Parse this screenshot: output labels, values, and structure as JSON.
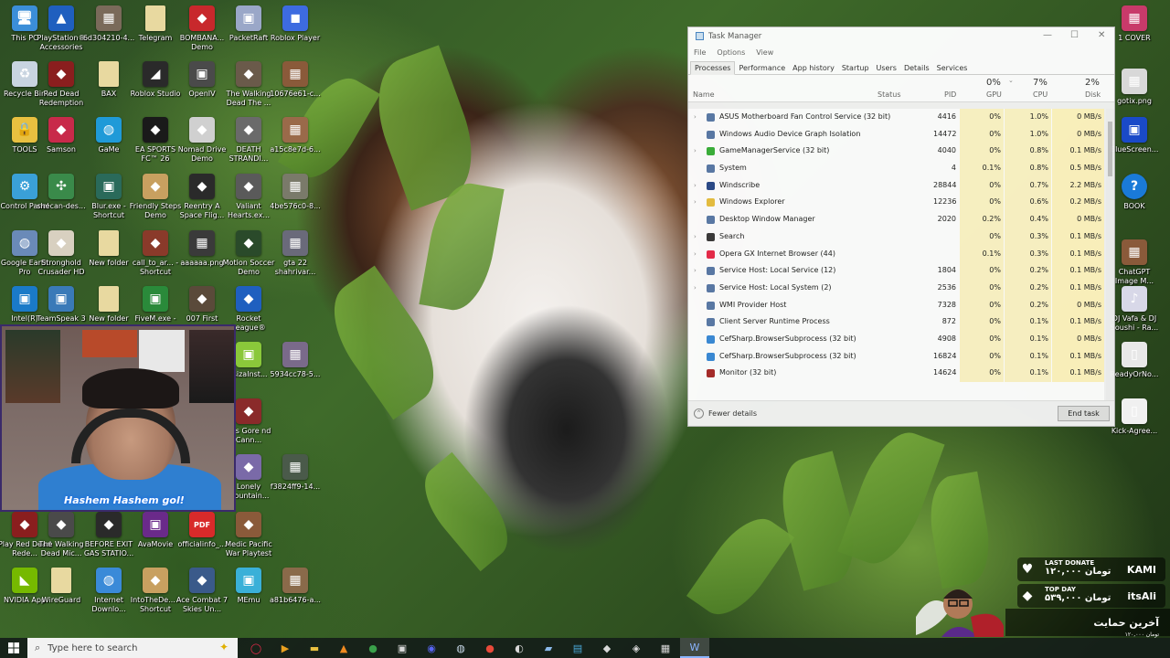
{
  "desktop_icons": [
    {
      "label": "This PC",
      "icon": "pc-icon",
      "color": "#3b8ed8",
      "col": 0,
      "row": 0
    },
    {
      "label": "PlayStation® Accessories",
      "icon": "playstation-icon",
      "color": "#1f5fbf",
      "col": 1,
      "row": 0
    },
    {
      "label": "6d304210-4...",
      "icon": "image-thumb-icon",
      "color": "#7a6a5a",
      "col": 2,
      "row": 0
    },
    {
      "label": "Telegram",
      "icon": "folder-icon",
      "color": "#e8d9a0",
      "col": 3,
      "row": 0
    },
    {
      "label": "BOMBANA... Demo",
      "icon": "game-icon",
      "color": "#c8282c",
      "col": 4,
      "row": 0
    },
    {
      "label": "PacketRaft",
      "icon": "app-icon",
      "color": "#9aa7c8",
      "col": 5,
      "row": 0
    },
    {
      "label": "Roblox Player",
      "icon": "roblox-icon",
      "color": "#3d6be0",
      "col": 6,
      "row": 0
    },
    {
      "label": "Recycle Bin",
      "icon": "recycle-bin-icon",
      "color": "#c8d4e0",
      "col": 0,
      "row": 1
    },
    {
      "label": "Red Dead Redemption",
      "icon": "game-icon",
      "color": "#8a1e1e",
      "col": 1,
      "row": 1
    },
    {
      "label": "BAX",
      "icon": "folder-icon",
      "color": "#e8d9a0",
      "col": 2,
      "row": 1
    },
    {
      "label": "Roblox Studio",
      "icon": "roblox-studio-icon",
      "color": "#2a2a2a",
      "col": 3,
      "row": 1
    },
    {
      "label": "OpenIV",
      "icon": "app-icon",
      "color": "#4a4a4a",
      "col": 4,
      "row": 1
    },
    {
      "label": "The Walking Dead The ...",
      "icon": "game-icon",
      "color": "#6a5a4a",
      "col": 5,
      "row": 1
    },
    {
      "label": "10676e61-c...",
      "icon": "image-thumb-icon",
      "color": "#8a5a3a",
      "col": 6,
      "row": 1
    },
    {
      "label": "TOOLS",
      "icon": "lock-icon",
      "color": "#e8c040",
      "col": 0,
      "row": 2
    },
    {
      "label": "Samson",
      "icon": "game-icon",
      "color": "#c82a4a",
      "col": 1,
      "row": 2
    },
    {
      "label": "GaMe",
      "icon": "globe-icon",
      "color": "#1f9ad8",
      "col": 2,
      "row": 2
    },
    {
      "label": "EA SPORTS FC™ 26",
      "icon": "game-icon",
      "color": "#1a1a1a",
      "col": 3,
      "row": 2
    },
    {
      "label": "Nomad Drive Demo",
      "icon": "game-icon",
      "color": "#d0d0d0",
      "col": 4,
      "row": 2
    },
    {
      "label": "DEATH STRANDI...",
      "icon": "game-icon",
      "color": "#6a6a6a",
      "col": 5,
      "row": 2
    },
    {
      "label": "a15c8e7d-6...",
      "icon": "image-thumb-icon",
      "color": "#9a6a4a",
      "col": 6,
      "row": 2
    },
    {
      "label": "Control Panel",
      "icon": "control-panel-icon",
      "color": "#3aa0d8",
      "col": 0,
      "row": 3
    },
    {
      "label": "shecan-des...",
      "icon": "network-icon",
      "color": "#3a8a4a",
      "col": 1,
      "row": 3
    },
    {
      "label": "Blur.exe - Shortcut",
      "icon": "app-icon",
      "color": "#2a6a5a",
      "col": 2,
      "row": 3
    },
    {
      "label": "Friendly Steps Demo",
      "icon": "game-icon",
      "color": "#c8a060",
      "col": 3,
      "row": 3
    },
    {
      "label": "Reentry A Space Flig...",
      "icon": "game-icon",
      "color": "#2a2a2a",
      "col": 4,
      "row": 3
    },
    {
      "label": "Valiant Hearts.ex...",
      "icon": "game-icon",
      "color": "#5a5a5a",
      "col": 5,
      "row": 3
    },
    {
      "label": "4be576c0-8...",
      "icon": "image-thumb-icon",
      "color": "#7a7a6a",
      "col": 6,
      "row": 3
    },
    {
      "label": "Google Earth Pro",
      "icon": "globe-icon",
      "color": "#6a8ab8",
      "col": 0,
      "row": 4
    },
    {
      "label": "Stronghold Crusader HD",
      "icon": "game-icon",
      "color": "#d8d0c0",
      "col": 1,
      "row": 4
    },
    {
      "label": "New folder",
      "icon": "folder-icon",
      "color": "#e8d9a0",
      "col": 2,
      "row": 4
    },
    {
      "label": "call_to_ar... - Shortcut",
      "icon": "game-icon",
      "color": "#8a3a2a",
      "col": 3,
      "row": 4
    },
    {
      "label": "aaaaaa.png",
      "icon": "image-thumb-icon",
      "color": "#3a3a3a",
      "col": 4,
      "row": 4
    },
    {
      "label": "Motion Soccer Demo",
      "icon": "game-icon",
      "color": "#2a4a2a",
      "col": 5,
      "row": 4
    },
    {
      "label": "gta 22 shahrivar...",
      "icon": "image-thumb-icon",
      "color": "#6a6a7a",
      "col": 6,
      "row": 4
    },
    {
      "label": "Intel(R)",
      "icon": "app-icon",
      "color": "#1a7ac8",
      "col": 0,
      "row": 5
    },
    {
      "label": "TeamSpeak 3",
      "icon": "app-icon",
      "color": "#3a7ab8",
      "col": 1,
      "row": 5
    },
    {
      "label": "New folder",
      "icon": "folder-icon",
      "color": "#e8d9a0",
      "col": 2,
      "row": 5
    },
    {
      "label": "FiveM.exe -",
      "icon": "app-icon",
      "color": "#2a8a3a",
      "col": 3,
      "row": 5
    },
    {
      "label": "007 First",
      "icon": "game-icon",
      "color": "#5a4a3a",
      "col": 4,
      "row": 5
    },
    {
      "label": "Rocket League®",
      "icon": "game-icon",
      "color": "#1f5fbf",
      "col": 5,
      "row": 5
    },
    {
      "label": "rsizaInst...",
      "icon": "app-icon",
      "color": "#8ac83a",
      "col": 5,
      "row": 6
    },
    {
      "label": "5934cc78-5...",
      "icon": "image-thumb-icon",
      "color": "#7a6a8a",
      "col": 6,
      "row": 6
    },
    {
      "label": "uns Gore nd Cann...",
      "icon": "game-icon",
      "color": "#8a2a2a",
      "col": 5,
      "row": 7
    },
    {
      "label": "Lonely Mountain...",
      "icon": "game-icon",
      "color": "#7a6aa8",
      "col": 5,
      "row": 8
    },
    {
      "label": "f3824ff9-14...",
      "icon": "image-thumb-icon",
      "color": "#4a5a4a",
      "col": 6,
      "row": 8
    },
    {
      "label": "Play Red Dead Rede...",
      "icon": "game-icon",
      "color": "#8a1e1e",
      "col": 0,
      "row": 9
    },
    {
      "label": "The Walking Dead Mic...",
      "icon": "game-icon",
      "color": "#4a4a4a",
      "col": 1,
      "row": 9
    },
    {
      "label": "BEFORE EXIT GAS STATIO...",
      "icon": "game-icon",
      "color": "#2a2a2a",
      "col": 2,
      "row": 9
    },
    {
      "label": "AvaMovie",
      "icon": "app-icon",
      "color": "#6a2a8a",
      "col": 3,
      "row": 9
    },
    {
      "label": "officialinfo_...",
      "icon": "pdf-icon",
      "color": "#d82a2a",
      "col": 4,
      "row": 9
    },
    {
      "label": "Medic Pacific War Playtest",
      "icon": "game-icon",
      "color": "#8a5a3a",
      "col": 5,
      "row": 9
    },
    {
      "label": "NVIDIA App",
      "icon": "nvidia-icon",
      "color": "#76b900",
      "col": 0,
      "row": 10
    },
    {
      "label": "WireGuard",
      "icon": "folder-icon",
      "color": "#e8d9a0",
      "col": 1,
      "row": 10
    },
    {
      "label": "Internet Downlo...",
      "icon": "globe-icon",
      "color": "#3a8ad8",
      "col": 2,
      "row": 10
    },
    {
      "label": "IntoTheDe... - Shortcut",
      "icon": "game-icon",
      "color": "#c8a060",
      "col": 3,
      "row": 10
    },
    {
      "label": "Ace Combat 7 Skies Un...",
      "icon": "game-icon",
      "color": "#3a5a8a",
      "col": 4,
      "row": 10
    },
    {
      "label": "MEmu",
      "icon": "app-icon",
      "color": "#3ab0d8",
      "col": 5,
      "row": 10
    },
    {
      "label": "a81b6476-a...",
      "icon": "image-thumb-icon",
      "color": "#8a6a4a",
      "col": 6,
      "row": 10
    }
  ],
  "right_icons": [
    {
      "label": "1 COVER",
      "icon": "image-thumb-icon",
      "color": "#c83a6a",
      "row": 0
    },
    {
      "label": "gotix.png",
      "icon": "image-thumb-icon",
      "color": "#d8d8d8",
      "row": 1
    },
    {
      "label": "BlueScreen...",
      "icon": "app-icon",
      "color": "#1a4ac8",
      "row": 2
    },
    {
      "label": "BOOK",
      "icon": "help-icon",
      "color": "#1a7ad8",
      "row": 3
    },
    {
      "label": "ChatGPT Image M...",
      "icon": "image-thumb-icon",
      "color": "#8a5a3a",
      "row": 4
    },
    {
      "label": "DJ Vafa & DJ Soushi - Ra...",
      "icon": "audio-file-icon",
      "color": "#d8d8e8",
      "row": 5
    },
    {
      "label": "ReadyOrNo...",
      "icon": "file-icon",
      "color": "#e8e8e8",
      "row": 6
    },
    {
      "label": "Kick-Agree...",
      "icon": "file-icon",
      "color": "#f0f0f0",
      "row": 7
    }
  ],
  "task_manager": {
    "title": "Task Manager",
    "menu": [
      "File",
      "Options",
      "View"
    ],
    "tabs": [
      "Processes",
      "Performance",
      "App history",
      "Startup",
      "Users",
      "Details",
      "Services"
    ],
    "columns": {
      "name": "Name",
      "status": "Status",
      "pid": "PID",
      "gpu": "GPU",
      "cpu": "CPU",
      "disk": "Disk"
    },
    "totals": {
      "gpu": "0%",
      "cpu": "7%",
      "disk": "2%"
    },
    "processes": [
      {
        "name": "ASUS Motherboard Fan Control Service (32 bit)",
        "pid": "4416",
        "gpu": "0%",
        "cpu": "1.0%",
        "disk": "0 MB/s",
        "expand": true,
        "icon_color": "#5a7aa8"
      },
      {
        "name": "Windows Audio Device Graph Isolation",
        "pid": "14472",
        "gpu": "0%",
        "cpu": "1.0%",
        "disk": "0 MB/s",
        "expand": false,
        "icon_color": "#5a7aa8"
      },
      {
        "name": "GameManagerService (32 bit)",
        "pid": "4040",
        "gpu": "0%",
        "cpu": "0.8%",
        "disk": "0.1 MB/s",
        "expand": true,
        "icon_color": "#3ab03a"
      },
      {
        "name": "System",
        "pid": "4",
        "gpu": "0.1%",
        "cpu": "0.8%",
        "disk": "0.5 MB/s",
        "expand": false,
        "icon_color": "#5a7aa8"
      },
      {
        "name": "Windscribe",
        "pid": "28844",
        "gpu": "0%",
        "cpu": "0.7%",
        "disk": "2.2 MB/s",
        "expand": true,
        "icon_color": "#2a4a8a"
      },
      {
        "name": "Windows Explorer",
        "pid": "12236",
        "gpu": "0%",
        "cpu": "0.6%",
        "disk": "0.2 MB/s",
        "expand": true,
        "icon_color": "#e8c040"
      },
      {
        "name": "Desktop Window Manager",
        "pid": "2020",
        "gpu": "0.2%",
        "cpu": "0.4%",
        "disk": "0 MB/s",
        "expand": false,
        "icon_color": "#5a7aa8"
      },
      {
        "name": "Search",
        "pid": "",
        "gpu": "0%",
        "cpu": "0.3%",
        "disk": "0.1 MB/s",
        "expand": true,
        "icon_color": "#3a3a3a"
      },
      {
        "name": "Opera GX Internet Browser (44)",
        "pid": "",
        "gpu": "0.1%",
        "cpu": "0.3%",
        "disk": "0.1 MB/s",
        "expand": true,
        "icon_color": "#e82a4a"
      },
      {
        "name": "Service Host: Local Service (12)",
        "pid": "1804",
        "gpu": "0%",
        "cpu": "0.2%",
        "disk": "0.1 MB/s",
        "expand": true,
        "icon_color": "#5a7aa8"
      },
      {
        "name": "Service Host: Local System (2)",
        "pid": "2536",
        "gpu": "0%",
        "cpu": "0.2%",
        "disk": "0.1 MB/s",
        "expand": true,
        "icon_color": "#5a7aa8"
      },
      {
        "name": "WMI Provider Host",
        "pid": "7328",
        "gpu": "0%",
        "cpu": "0.2%",
        "disk": "0 MB/s",
        "expand": false,
        "icon_color": "#5a7aa8"
      },
      {
        "name": "Client Server Runtime Process",
        "pid": "872",
        "gpu": "0%",
        "cpu": "0.1%",
        "disk": "0.1 MB/s",
        "expand": false,
        "icon_color": "#5a7aa8"
      },
      {
        "name": "CefSharp.BrowserSubprocess (32 bit)",
        "pid": "4908",
        "gpu": "0%",
        "cpu": "0.1%",
        "disk": "0 MB/s",
        "expand": false,
        "icon_color": "#3a8ad8"
      },
      {
        "name": "CefSharp.BrowserSubprocess (32 bit)",
        "pid": "16824",
        "gpu": "0%",
        "cpu": "0.1%",
        "disk": "0.1 MB/s",
        "expand": false,
        "icon_color": "#3a8ad8"
      },
      {
        "name": "Monitor (32 bit)",
        "pid": "14624",
        "gpu": "0%",
        "cpu": "0.1%",
        "disk": "0.1 MB/s",
        "expand": false,
        "icon_color": "#a82a2a"
      }
    ],
    "fewer_details": "Fewer details",
    "end_task": "End task"
  },
  "webcam": {
    "name_tag": "Hashem Hashem gol!"
  },
  "donations": {
    "last_label": "LAST DONATE",
    "last_amount": "۱۲۰,۰۰۰ تومان",
    "last_name": "KAMI",
    "top_label": "TOP DAY",
    "top_amount": "۵۳۹,۰۰۰ تومان",
    "top_name": "itsAli",
    "support_title": "آخرین حمایت",
    "support_amount": "۱۲۰,۰۰۰ تومان"
  },
  "taskbar": {
    "search_placeholder": "Type here to search",
    "apps": [
      {
        "icon": "opera-gx-icon",
        "color": "#e82a4a",
        "glyph": "◯"
      },
      {
        "icon": "media-player-icon",
        "color": "#e8a020",
        "glyph": "▶"
      },
      {
        "icon": "file-explorer-icon",
        "color": "#e8c040",
        "glyph": "▬"
      },
      {
        "icon": "vlc-icon",
        "color": "#f08a20",
        "glyph": "▲"
      },
      {
        "icon": "chrome-icon",
        "color": "#3aa04a",
        "glyph": "●"
      },
      {
        "icon": "app-window-icon",
        "color": "#d8d8d8",
        "glyph": "▣"
      },
      {
        "icon": "discord-icon",
        "color": "#5865f2",
        "glyph": "◉"
      },
      {
        "icon": "steam-icon",
        "color": "#c8d8e8",
        "glyph": "◍"
      },
      {
        "icon": "chrome-icon",
        "color": "#e84a3a",
        "glyph": "●"
      },
      {
        "icon": "obs-icon",
        "color": "#d8d8d8",
        "glyph": "◐"
      },
      {
        "icon": "notes-icon",
        "color": "#8ab8e8",
        "glyph": "▰"
      },
      {
        "icon": "screen-icon",
        "color": "#4aa8d8",
        "glyph": "▤"
      },
      {
        "icon": "leaf-app-icon",
        "color": "#d8d8d8",
        "glyph": "◆"
      },
      {
        "icon": "vpn-icon",
        "color": "#d8d8d8",
        "glyph": "◈"
      },
      {
        "icon": "window-icon",
        "color": "#d8d8d8",
        "glyph": "▦"
      },
      {
        "icon": "task-manager-icon",
        "color": "#8ab4ff",
        "glyph": "W",
        "active": true
      }
    ]
  }
}
